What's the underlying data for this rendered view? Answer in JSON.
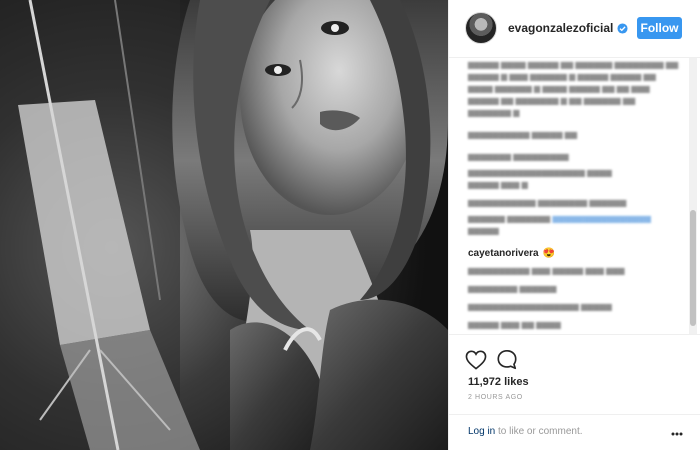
{
  "post": {
    "username": "evagonzalezoficial",
    "follow_label": "Follow",
    "likes": "11,972 likes",
    "time_ago": "2 HOURS AGO",
    "login_link": "Log in",
    "login_suffix": " to like or comment."
  },
  "visible_comment": {
    "username": "cayetanorivera",
    "emoji": "😍"
  },
  "icons": {
    "verified": "verified-badge-icon",
    "like": "heart-icon",
    "comment": "speech-bubble-icon",
    "more": "more-options-icon"
  },
  "colors": {
    "follow_button": "#3897f0",
    "verified_badge": "#3897f0",
    "login_link": "#003569"
  }
}
